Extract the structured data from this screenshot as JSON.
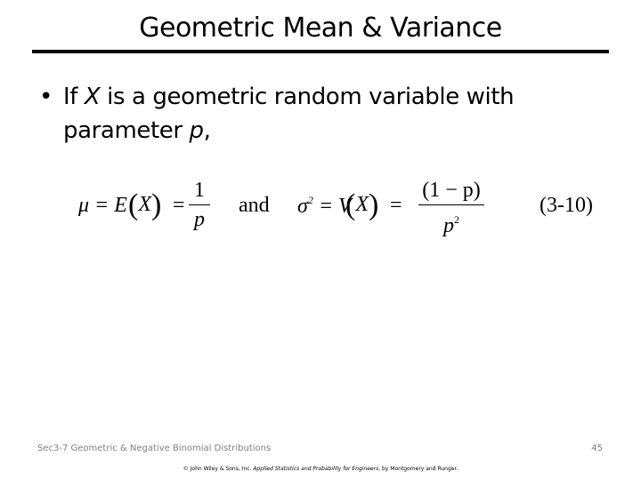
{
  "slide": {
    "title": "Geometric Mean & Variance",
    "bullet": {
      "prefix": "If ",
      "var_x": "X",
      "middle": " is a geometric random variable with parameter ",
      "var_p": "p",
      "suffix": ","
    },
    "formula": {
      "mean_lhs": "μ = E",
      "mean_arg": "X",
      "mean_eq": "=",
      "mean_num": "1",
      "mean_den": "p",
      "connector": "and",
      "var_lhs": "σ",
      "var_lhs_exp": "2",
      "var_mid": " = V",
      "var_arg": "X",
      "var_eq": "=",
      "var_num": "(1 − p)",
      "var_den": "p",
      "var_den_exp": "2",
      "equation_number": "(3-10)"
    },
    "footer": {
      "section": "Sec3-7 Geometric & Negative Binomial Distributions",
      "page_number": "45",
      "copyright_prefix": "© John Wiley & Sons, Inc. ",
      "copyright_book": "Applied Statistics and Probability for Engineers",
      "copyright_suffix": ", by Montgomery and Runger."
    }
  }
}
